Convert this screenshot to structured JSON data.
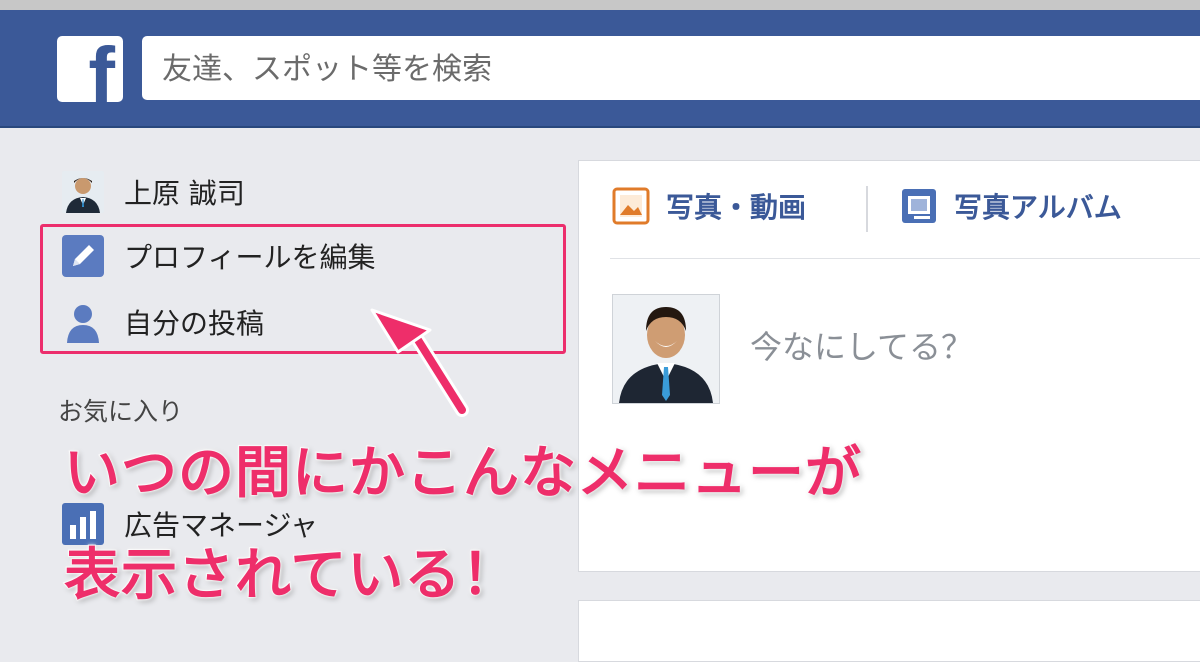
{
  "header": {
    "logo_text": "f",
    "search_placeholder": "友達、スポット等を検索"
  },
  "sidebar": {
    "items": [
      {
        "label": "上原 誠司",
        "icon": "profile-photo"
      },
      {
        "label": "プロフィールを編集",
        "icon": "pencil-icon"
      },
      {
        "label": "自分の投稿",
        "icon": "person-icon"
      },
      {
        "label": "広告マネージャ",
        "icon": "bar-chart-icon"
      }
    ],
    "section_favorites": "お気に入り"
  },
  "composer": {
    "tab_photo_video": "写真・動画",
    "tab_photo_album": "写真アルバム",
    "placeholder": "今なにしてる？"
  },
  "annotation": {
    "line1": "いつの間にかこんなメニューが",
    "line2": "表示されている！",
    "color": "#ee2e6a"
  },
  "colors": {
    "facebook_blue": "#3b5998",
    "highlight_pink": "#ec2e6c"
  }
}
